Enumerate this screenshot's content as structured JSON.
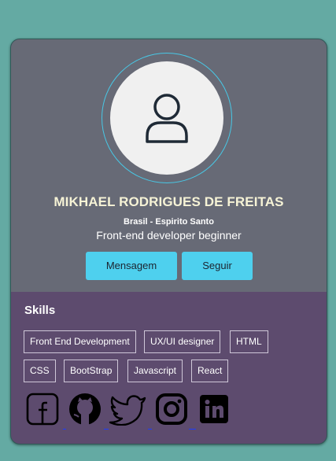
{
  "profile": {
    "name": "MIKHAEL RODRIGUES DE FREITAS",
    "location": "Brasil - Espirito Santo",
    "role": "Front-end developer beginner",
    "avatar_icon": "user-icon"
  },
  "actions": {
    "message_label": "Mensagem",
    "follow_label": "Seguir"
  },
  "skills": {
    "title": "Skills",
    "items": [
      "Front End Development",
      "UX/UI designer",
      "HTML",
      "CSS",
      "BootStrap",
      "Javascript",
      "React"
    ]
  },
  "social": [
    "facebook-icon",
    "github-icon",
    "twitter-icon",
    "instagram-icon",
    "linkedin-icon"
  ],
  "colors": {
    "page_background": "#64aaa3",
    "header_background": "#676a76",
    "skills_background": "#5d4b6e",
    "button": "#4ed0ee",
    "name_text": "#f6f3d6",
    "avatar_ring": "#48c8e6"
  }
}
